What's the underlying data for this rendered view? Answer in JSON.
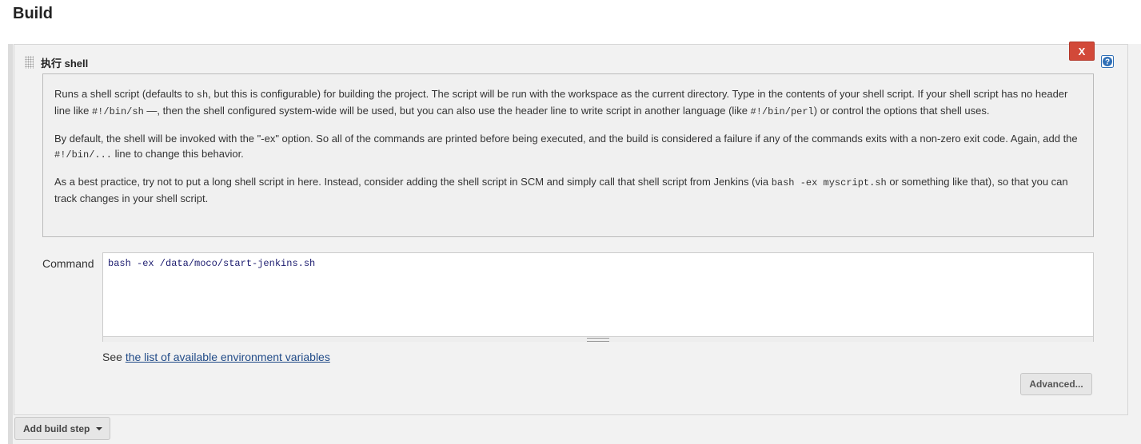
{
  "page_title": "Build",
  "step": {
    "title": "执行 shell",
    "delete_label": "X",
    "help_icon": "question-mark-help-icon",
    "drag_icon": "drag-handle-icon",
    "colors": {
      "delete": "#d24939",
      "help": "#2f6fb6",
      "link": "#204a87"
    }
  },
  "help": {
    "p1": {
      "t1": "Runs a shell script (defaults to ",
      "c1": "sh",
      "t2": ", but this is configurable) for building the project. The script will be run with the workspace as the current directory. Type in the contents of your shell script. If your shell script has no header line like ",
      "c2": "#!/bin/sh",
      "t3": " —, then the shell configured system-wide will be used, but you can also use the header line to write script in another language (like ",
      "c3": "#!/bin/perl",
      "t4": ") or control the options that shell uses."
    },
    "p2": {
      "t1": "By default, the shell will be invoked with the \"-ex\" option. So all of the commands are printed before being executed, and the build is considered a failure if any of the commands exits with a non-zero exit code. Again, add the ",
      "c1": "#!/bin/...",
      "t2": " line to change this behavior."
    },
    "p3": {
      "t1": "As a best practice, try not to put a long shell script in here. Instead, consider adding the shell script in SCM and simply call that shell script from Jenkins (via ",
      "c1": "bash -ex myscript.sh",
      "t2": " or something like that), so that you can track changes in your shell script."
    }
  },
  "command": {
    "label": "Command",
    "value": "bash -ex /data/moco/start-jenkins.sh"
  },
  "env": {
    "prefix": "See ",
    "link_text": "the list of available environment variables"
  },
  "advanced_label": "Advanced...",
  "add_step_label": "Add build step"
}
